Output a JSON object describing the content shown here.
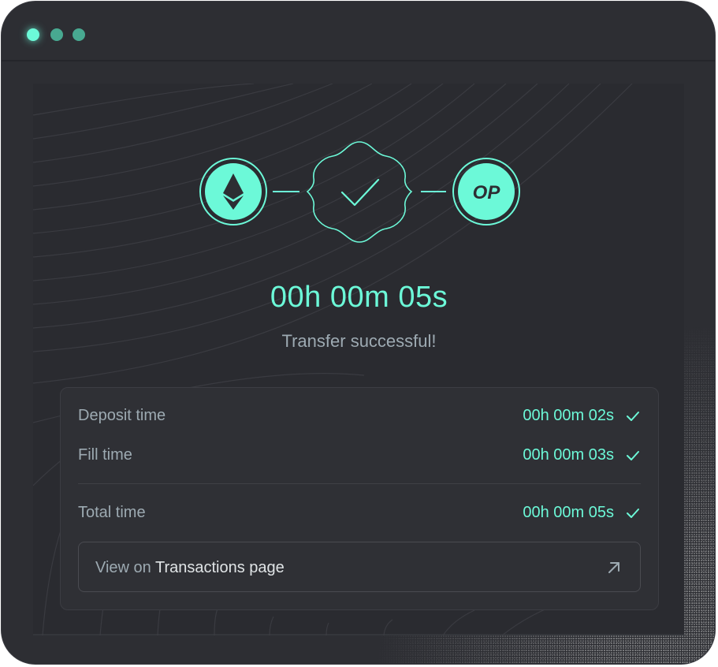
{
  "window": {
    "controls": [
      "close-dot",
      "minimize-dot",
      "maximize-dot"
    ]
  },
  "route": {
    "from_chain_icon": "ethereum-icon",
    "to_chain_label": "OP",
    "to_chain_icon": "optimism-icon",
    "status_icon": "success-check-badge-icon"
  },
  "timer": {
    "elapsed": "00h 00m 05s",
    "status": "Transfer successful!"
  },
  "details": {
    "rows": [
      {
        "label": "Deposit time",
        "value": "00h 00m 02s"
      },
      {
        "label": "Fill time",
        "value": "00h 00m 03s"
      },
      {
        "label": "Total time",
        "value": "00h 00m 05s"
      }
    ],
    "link": {
      "prefix": "View on",
      "target": "Transactions page",
      "icon": "arrow-up-right-icon"
    }
  },
  "colors": {
    "accent": "#6cf9d8",
    "background": "#2d2e33",
    "muted_text": "#9daab2"
  }
}
